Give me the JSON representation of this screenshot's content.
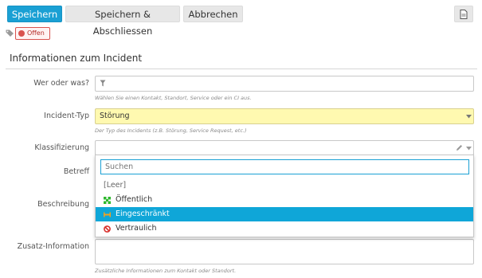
{
  "toolbar": {
    "save_label": "Speichern",
    "save_close_label": "Speichern & Abschliessen",
    "cancel_label": "Abbrechen"
  },
  "status": {
    "label": "Offen"
  },
  "section": {
    "title": "Informationen zum Incident"
  },
  "fields": {
    "who_what": {
      "label": "Wer oder was?",
      "hint": "Wählen Sie einen Kontakt, Standort, Service oder ein CI aus."
    },
    "incident_type": {
      "label": "Incident-Typ",
      "value": "Störung",
      "hint": "Der Typ des Incidents (z.B. Störung, Service Request, etc.)"
    },
    "classification": {
      "label": "Klassifizierung"
    },
    "subject": {
      "label": "Betreff"
    },
    "description": {
      "label": "Beschreibung"
    },
    "extra_info": {
      "label": "Zusatz-Information",
      "hint": "Zusätzliche Informationen zum Kontakt oder Standort."
    }
  },
  "dropdown": {
    "search_placeholder": "Suchen",
    "options": [
      {
        "label": "[Leer]",
        "icon": "none"
      },
      {
        "label": "Öffentlich",
        "icon": "public-icon",
        "color": "#2eb82e"
      },
      {
        "label": "Eingeschränkt",
        "icon": "restricted-icon",
        "color": "#f0a020",
        "selected": true
      },
      {
        "label": "Vertraulich",
        "icon": "forbidden-icon",
        "color": "#d9302c"
      }
    ]
  },
  "colors": {
    "primary": "#1aa0d4",
    "highlight": "#fff9b0",
    "selected": "#0fa6d8"
  }
}
